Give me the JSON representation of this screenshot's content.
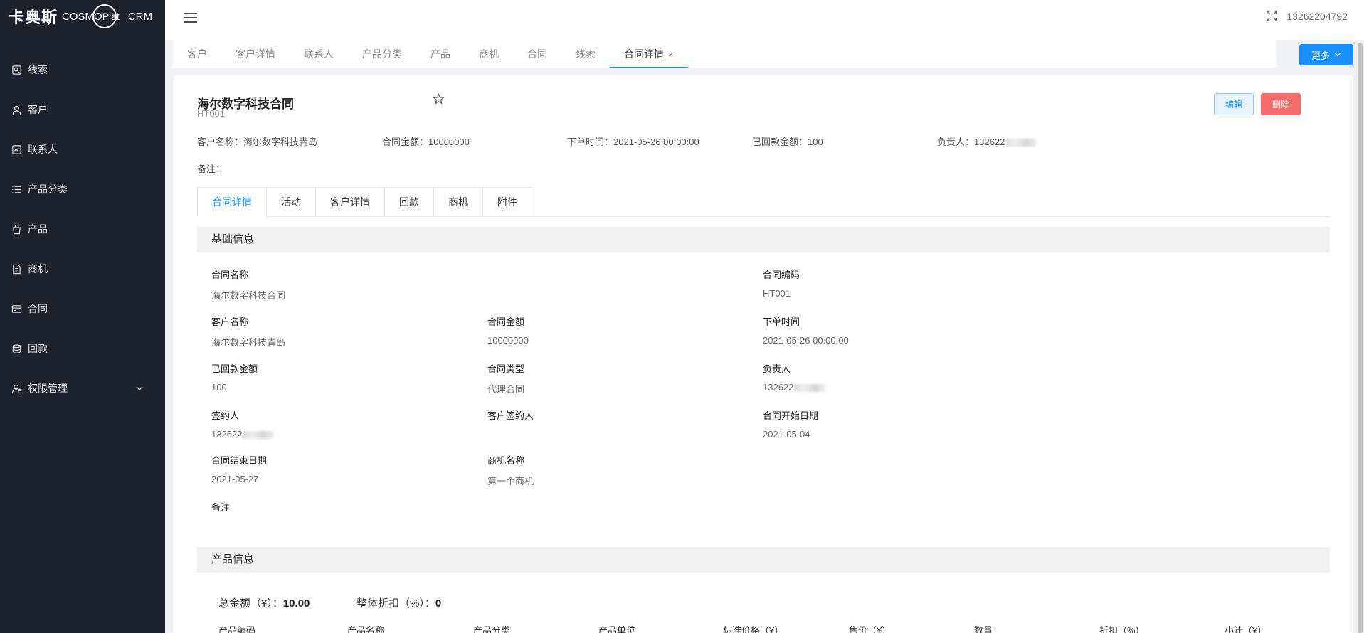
{
  "app": {
    "logo_cn": "卡奥斯",
    "logo_cosmo": "COSMO",
    "logo_plat": "Plat",
    "logo_crm": "CRM"
  },
  "sidebar": {
    "items": [
      {
        "label": "线索",
        "icon": "clue-icon"
      },
      {
        "label": "客户",
        "icon": "user-icon"
      },
      {
        "label": "联系人",
        "icon": "contact-icon"
      },
      {
        "label": "产品分类",
        "icon": "list-icon"
      },
      {
        "label": "产品",
        "icon": "bag-icon"
      },
      {
        "label": "商机",
        "icon": "document-icon"
      },
      {
        "label": "合同",
        "icon": "card-icon"
      },
      {
        "label": "回款",
        "icon": "database-icon"
      },
      {
        "label": "权限管理",
        "icon": "user-lock-icon"
      }
    ]
  },
  "header": {
    "user_phone": "13262204792"
  },
  "navtabs": {
    "items": [
      "客户",
      "客户详情",
      "联系人",
      "产品分类",
      "产品",
      "商机",
      "合同",
      "线索",
      "合同详情"
    ],
    "close_label": "×",
    "more_label": "更多"
  },
  "contract": {
    "title": "海尔数字科技合同",
    "code": "HT001",
    "edit_label": "编辑",
    "delete_label": "删除",
    "summary": {
      "customer_label": "客户名称：",
      "customer_value": "海尔数字科技青岛",
      "amount_label": "合同金额：",
      "amount_value": "10000000",
      "order_time_label": "下单时间：",
      "order_time_value": "2021-05-26 00:00:00",
      "received_label": "已回款金额：",
      "received_value": "100",
      "owner_label": "负责人：",
      "owner_value": "132622"
    },
    "remark_label": "备注："
  },
  "subtabs": [
    "合同详情",
    "活动",
    "客户详情",
    "回款",
    "商机",
    "附件"
  ],
  "basic": {
    "title": "基础信息",
    "contract_name_k": "合同名称",
    "contract_name_v": "海尔数字科技合同",
    "contract_code_k": "合同编码",
    "contract_code_v": "HT001",
    "customer_name_k": "客户名称",
    "customer_name_v": "海尔数字科技青岛",
    "amount_k": "合同金额",
    "amount_v": "10000000",
    "order_time_k": "下单时间",
    "order_time_v": "2021-05-26 00:00:00",
    "received_k": "已回款金额",
    "received_v": "100",
    "type_k": "合同类型",
    "type_v": "代理合同",
    "owner_k": "负责人",
    "owner_v": "132622",
    "signer_k": "签约人",
    "signer_v": "132622",
    "cust_signer_k": "客户签约人",
    "start_k": "合同开始日期",
    "start_v": "2021-05-04",
    "end_k": "合同结束日期",
    "end_v": "2021-05-27",
    "opportunity_k": "商机名称",
    "opportunity_v": "第一个商机",
    "remark_k": "备注"
  },
  "product": {
    "title": "产品信息",
    "total_label": "总金额（¥）：",
    "total_value": "10.00",
    "discount_label": "整体折扣（%）：",
    "discount_value": "0",
    "columns": [
      "产品编码",
      "产品名称",
      "产品分类",
      "产品单位",
      "标准价格（¥）",
      "售价（¥）",
      "数量",
      "折扣（%）",
      "小计（¥）"
    ]
  }
}
